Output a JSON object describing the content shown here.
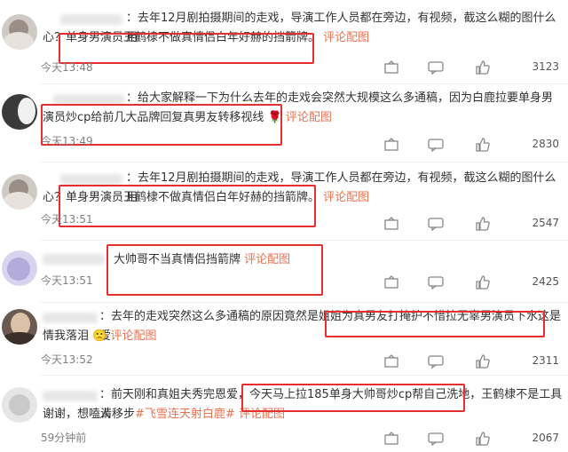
{
  "comments": [
    {
      "text_a": "：去年12月剧拍摄期间的走戏，导演工作人员都在旁边，有视频，截这么糊的图什么用",
      "text_b": "心？",
      "highlight": "单身男演员王鹤棣不做真情侣白年好赫的挡箭牌。",
      "link": "评论配图",
      "time": "今天13:48",
      "likes": "3123"
    },
    {
      "text_a": "：给大家解释一下为什么去年的走戏会突然大规模这么多通稿，因为白鹿拉要单身男",
      "text_b": "",
      "highlight": "演员炒cp给前几大品牌回复真男友转移视线",
      "emoji": "🌹",
      "link": "评论配图",
      "time": "今天13:49",
      "likes": "2830"
    },
    {
      "text_a": "：去年12月剧拍摄期间的走戏，导演工作人员都在旁边，有视频，截这么糊的图什么用",
      "text_b": "心？",
      "highlight": "单身男演员王鹤棣不做真情侣白年好赫的挡箭牌。",
      "link": "评论配图",
      "time": "今天13:51",
      "likes": "2547"
    },
    {
      "highlight": "大帅哥不当真情侣挡箭牌",
      "link": "评论配图",
      "time": "今天13:51",
      "likes": "2425"
    },
    {
      "text_a": "：去年的走戏突然这么多通稿的原因竟然是姐姐为",
      "highlight": "真男友打掩护不惜拉无辜男演员下水",
      "text_after": "这是爱",
      "text_b": "情我落泪",
      "emoji": "🙁",
      "link": "评论配图",
      "time": "今天13:52",
      "likes": "2311"
    },
    {
      "text_a": "：前天刚和真姐夫秀完恩爱，",
      "highlight": "今天马上拉185单身大帅哥炒cp帮自己洗地，",
      "text_after": "王鹤棣不是工具人",
      "text_b": "谢谢，想嗑请移步",
      "hashtag": "#飞雪连天射白鹿#",
      "link": "评论配图",
      "time": "59分钟前",
      "likes": "2067"
    }
  ]
}
